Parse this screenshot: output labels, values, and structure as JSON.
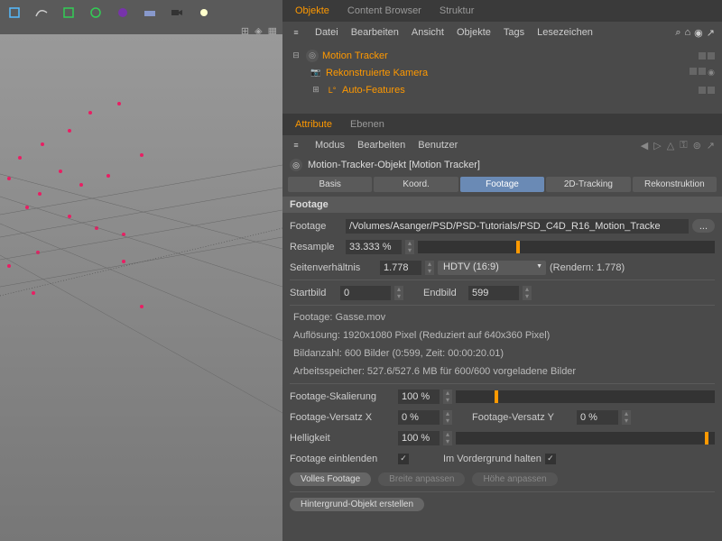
{
  "tabs": {
    "objects": "Objekte",
    "content_browser": "Content Browser",
    "struktur": "Struktur"
  },
  "menu": {
    "datei": "Datei",
    "bearbeiten": "Bearbeiten",
    "ansicht": "Ansicht",
    "objekte": "Objekte",
    "tags": "Tags",
    "lesezeichen": "Lesezeichen"
  },
  "tree": {
    "motion_tracker": "Motion Tracker",
    "rek_kamera": "Rekonstruierte Kamera",
    "auto_features": "Auto-Features"
  },
  "attr_tabs": {
    "attribute": "Attribute",
    "ebenen": "Ebenen"
  },
  "attr_menu": {
    "modus": "Modus",
    "bearbeiten": "Bearbeiten",
    "benutzer": "Benutzer"
  },
  "obj_title": "Motion-Tracker-Objekt [Motion Tracker]",
  "nav": {
    "basis": "Basis",
    "koord": "Koord.",
    "footage": "Footage",
    "tracking": "2D-Tracking",
    "rekon": "Rekonstruktion"
  },
  "section": "Footage",
  "form": {
    "footage_lbl": "Footage",
    "footage_path": "/Volumes/Asanger/PSD/PSD-Tutorials/PSD_C4D_R16_Motion_Tracke",
    "resample_lbl": "Resample",
    "resample_val": "33.333 %",
    "aspect_lbl": "Seitenverhältnis",
    "aspect_val": "1.778",
    "aspect_preset": "HDTV (16:9)",
    "render_txt": "(Rendern: 1.778)",
    "startbild_lbl": "Startbild",
    "startbild_val": "0",
    "endbild_lbl": "Endbild",
    "endbild_val": "599",
    "info_footage": "Footage: Gasse.mov",
    "info_res": "Auflösung: 1920x1080 Pixel (Reduziert auf 640x360 Pixel)",
    "info_frames": "Bildanzahl: 600 Bilder (0:599, Zeit: 00:00:20.01)",
    "info_mem": "Arbeitsspeicher: 527.6/527.6 MB für 600/600 vorgeladene Bilder",
    "scale_lbl": "Footage-Skalierung",
    "scale_val": "100 %",
    "offset_x_lbl": "Footage-Versatz X",
    "offset_x_val": "0 %",
    "offset_y_lbl": "Footage-Versatz Y",
    "offset_y_val": "0 %",
    "brightness_lbl": "Helligkeit",
    "brightness_val": "100 %",
    "show_footage_lbl": "Footage einblenden",
    "foreground_lbl": "Im Vordergrund halten",
    "full_btn": "Volles Footage",
    "width_btn": "Breite anpassen",
    "height_btn": "Höhe anpassen",
    "bg_btn": "Hintergrund-Objekt erstellen",
    "browse": "..."
  }
}
